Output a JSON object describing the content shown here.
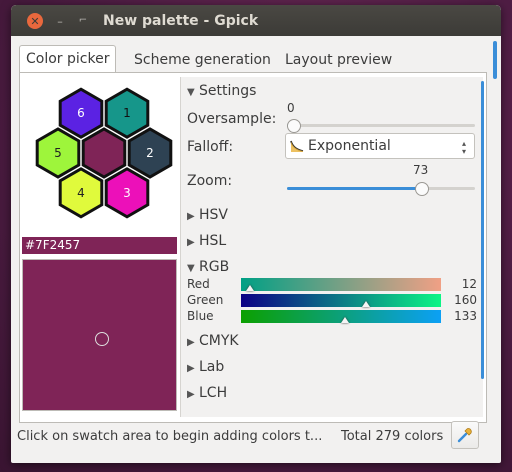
{
  "window": {
    "title": "New palette - Gpick"
  },
  "tabs": [
    {
      "label": "Color picker",
      "active": true
    },
    {
      "label": "Scheme generation",
      "active": false
    },
    {
      "label": "Layout preview",
      "active": false
    }
  ],
  "hexagons": [
    {
      "label": "1",
      "color": "#16968a"
    },
    {
      "label": "2",
      "color": "#2e4253"
    },
    {
      "label": "3",
      "color": "#ec10b9"
    },
    {
      "label": "4",
      "color": "#e0fa3c"
    },
    {
      "label": "5",
      "color": "#9ef53b"
    },
    {
      "label": "6",
      "color": "#5b22e3"
    },
    {
      "label": "",
      "color": "#7f2457"
    }
  ],
  "current_color": {
    "hex": "#7F2457"
  },
  "settings": {
    "header": "Settings",
    "oversample": {
      "label": "Oversample:",
      "value": 0,
      "min": 0,
      "max": 100
    },
    "falloff": {
      "label": "Falloff:",
      "value": "Exponential"
    },
    "zoom": {
      "label": "Zoom:",
      "value": 73,
      "min": 0,
      "max": 100
    }
  },
  "sections": {
    "hsv": "HSV",
    "hsl": "HSL",
    "rgb": "RGB",
    "cmyk": "CMYK",
    "lab": "Lab",
    "lch": "LCH"
  },
  "rgb": [
    {
      "label": "Red",
      "value": 12
    },
    {
      "label": "Green",
      "value": 160
    },
    {
      "label": "Blue",
      "value": 133
    }
  ],
  "statusbar": {
    "hint": "Click on swatch area to begin adding colors t...",
    "total": "Total 279 colors"
  },
  "icons": {
    "close": "close-icon",
    "minimize": "minimize-icon",
    "maximize": "maximize-icon",
    "picker": "eyedropper-icon"
  }
}
